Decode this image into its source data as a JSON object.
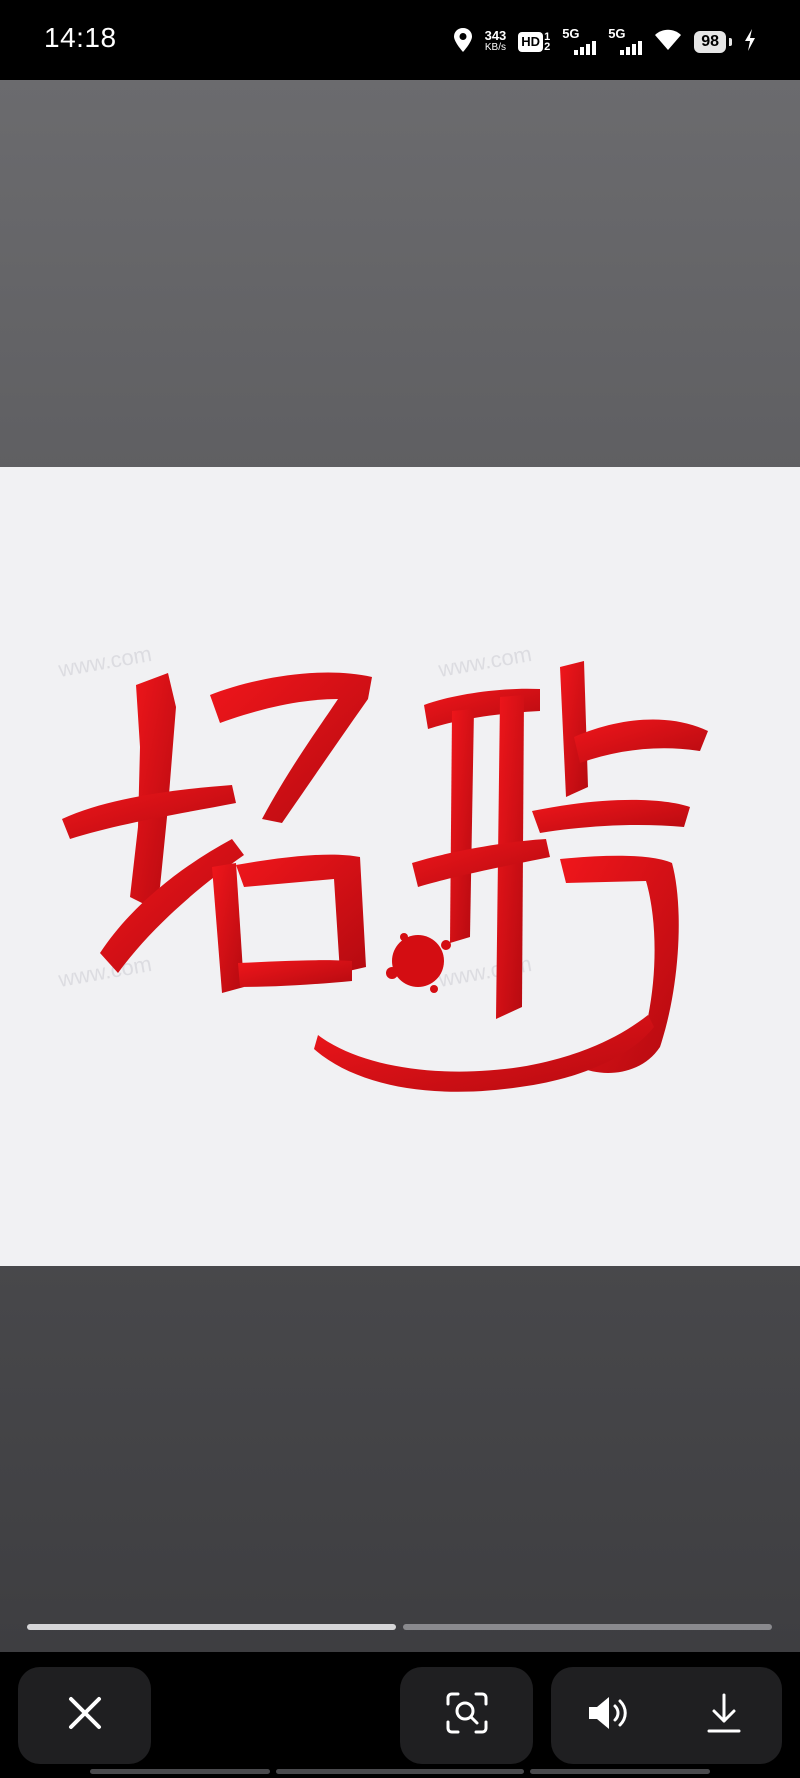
{
  "status_bar": {
    "time": "14:18",
    "net_speed_value": "343",
    "net_speed_unit": "KB/s",
    "hd_label": "HD",
    "hd_sim_top": "1",
    "hd_sim_bottom": "2",
    "sim1_network": "5G",
    "sim2_network": "5G",
    "battery_level": "98",
    "icons": [
      "location-icon",
      "wifi-icon",
      "charging-icon"
    ]
  },
  "viewer": {
    "image_text": "招聘",
    "image_watermark": "www.com",
    "image_colors": {
      "brush": "#d40d12",
      "background": "#f1f1f3"
    },
    "story_progress": {
      "segments": 2,
      "current": 1
    }
  },
  "toolbar": {
    "close_icon": "close-icon",
    "lens_icon": "image-search-icon",
    "sound_icon": "speaker-icon",
    "download_icon": "download-icon"
  }
}
